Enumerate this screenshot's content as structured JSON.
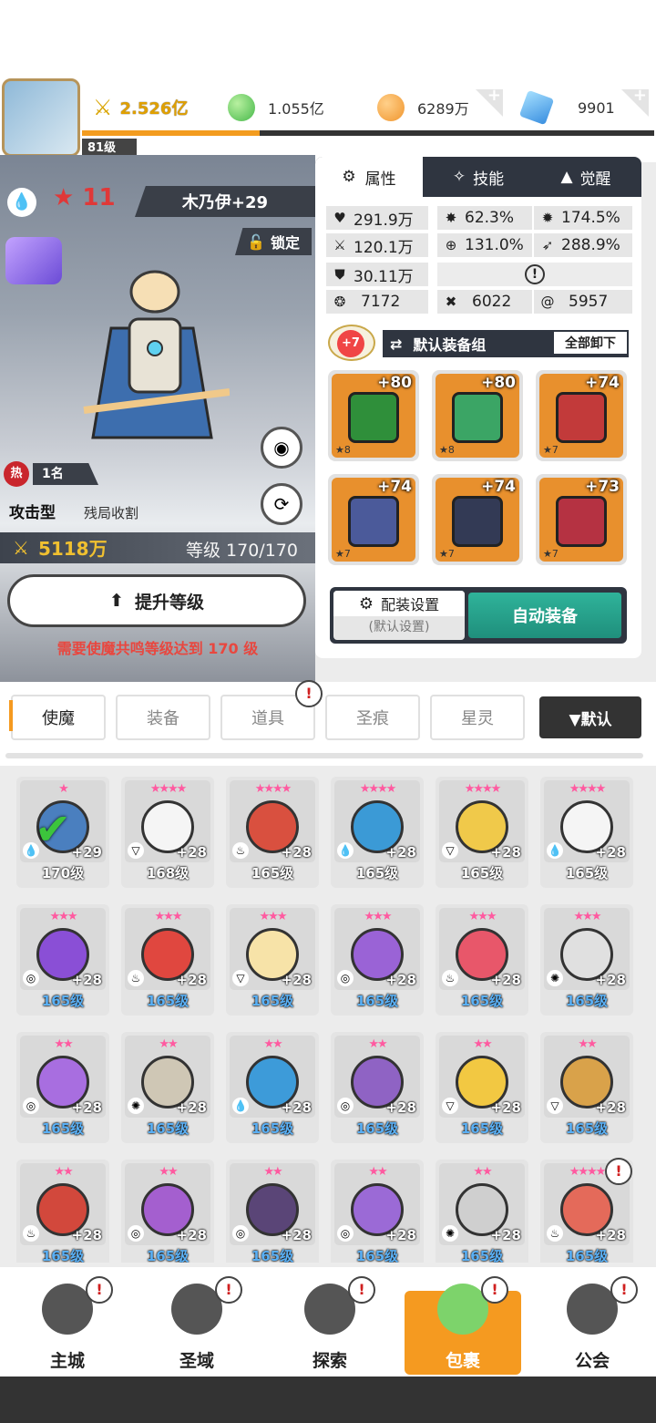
{
  "header": {
    "level": "81级",
    "power": "2.526亿",
    "currency1": "1.055亿",
    "currency2": "6289万",
    "currency3": "9901",
    "xp_progress": 0.31
  },
  "hero": {
    "star_count": "11",
    "name": "木乃伊+29",
    "lock_label": "锁定",
    "hot_badge": "热",
    "rank": "1名",
    "type": "攻击型",
    "subtitle": "残局收割",
    "power": "5118万",
    "level_text": "等级 170/170",
    "upgrade_button": "提升等级",
    "warning": "需要使魔共鸣等级达到 170 级"
  },
  "tabs": [
    {
      "label": "属性"
    },
    {
      "label": "技能"
    },
    {
      "label": "觉醒"
    }
  ],
  "stats": {
    "hp": "291.9万",
    "crit": "62.3%",
    "crit_dmg": "174.5%",
    "atk": "120.1万",
    "accuracy": "131.0%",
    "speed": "288.9%",
    "def": "30.11万",
    "s1": "7172",
    "s2": "6022",
    "s3": "5957"
  },
  "equipment": {
    "badge": "+7",
    "set_label": "默认装备组",
    "unequip_all": "全部卸下",
    "items": [
      {
        "plus": "+80",
        "stars": "★8",
        "color": "#2f8f3a"
      },
      {
        "plus": "+80",
        "stars": "★8",
        "color": "#3ba565"
      },
      {
        "plus": "+74",
        "stars": "★7",
        "color": "#c23a3a"
      },
      {
        "plus": "+74",
        "stars": "★7",
        "color": "#4b5a9a"
      },
      {
        "plus": "+74",
        "stars": "★7",
        "color": "#333a55"
      },
      {
        "plus": "+73",
        "stars": "★7",
        "color": "#b53242"
      }
    ],
    "config_label": "配装设置",
    "config_sub": "(默认设置)",
    "auto_equip": "自动装备"
  },
  "filters": [
    {
      "label": "使魔"
    },
    {
      "label": "装备"
    },
    {
      "label": "道具"
    },
    {
      "label": "圣痕"
    },
    {
      "label": "星灵"
    }
  ],
  "sort_label": "▼默认",
  "heroes": [
    {
      "level": "170级",
      "plus": "+29",
      "stars": "★",
      "color": "#4a7fbf",
      "elem": "💧"
    },
    {
      "level": "168级",
      "plus": "+28",
      "stars": "★★★★",
      "color": "#f5f5f5",
      "elem": "▽"
    },
    {
      "level": "165级",
      "plus": "+28",
      "stars": "★★★★",
      "color": "#d9503f",
      "elem": "♨"
    },
    {
      "level": "165级",
      "plus": "+28",
      "stars": "★★★★",
      "color": "#3b9ad6",
      "elem": "💧"
    },
    {
      "level": "165级",
      "plus": "+28",
      "stars": "★★★★",
      "color": "#f0c94a",
      "elem": "▽"
    },
    {
      "level": "165级",
      "plus": "+28",
      "stars": "★★★★",
      "color": "#f5f5f5",
      "elem": "💧"
    },
    {
      "level": "165级",
      "plus": "+28",
      "stars": "★★★",
      "color": "#8a4fd6",
      "elem": "◎"
    },
    {
      "level": "165级",
      "plus": "+28",
      "stars": "★★★",
      "color": "#e0473f",
      "elem": "♨"
    },
    {
      "level": "165级",
      "plus": "+28",
      "stars": "★★★",
      "color": "#f7e3a8",
      "elem": "▽"
    },
    {
      "level": "165级",
      "plus": "+28",
      "stars": "★★★",
      "color": "#9a63d6",
      "elem": "◎"
    },
    {
      "level": "165级",
      "plus": "+28",
      "stars": "★★★",
      "color": "#e8576a",
      "elem": "♨"
    },
    {
      "level": "165级",
      "plus": "+28",
      "stars": "★★★",
      "color": "#e0e0e0",
      "elem": "✺"
    },
    {
      "level": "165级",
      "plus": "+28",
      "stars": "★★",
      "color": "#a86ee0",
      "elem": "◎"
    },
    {
      "level": "165级",
      "plus": "+28",
      "stars": "★★",
      "color": "#cfc7b5",
      "elem": "✺"
    },
    {
      "level": "165级",
      "plus": "+28",
      "stars": "★★",
      "color": "#3d9bd9",
      "elem": "💧"
    },
    {
      "level": "165级",
      "plus": "+28",
      "stars": "★★",
      "color": "#8f63c4",
      "elem": "◎"
    },
    {
      "level": "165级",
      "plus": "+28",
      "stars": "★★",
      "color": "#f2c842",
      "elem": "▽"
    },
    {
      "level": "165级",
      "plus": "+28",
      "stars": "★★",
      "color": "#d9a24a",
      "elem": "▽"
    },
    {
      "level": "165级",
      "plus": "+28",
      "stars": "★★",
      "color": "#d2483c",
      "elem": "♨"
    },
    {
      "level": "165级",
      "plus": "+28",
      "stars": "★★",
      "color": "#a45fcf",
      "elem": "◎"
    },
    {
      "level": "165级",
      "plus": "+28",
      "stars": "★★",
      "color": "#5a4577",
      "elem": "◎"
    },
    {
      "level": "165级",
      "plus": "+28",
      "stars": "★★",
      "color": "#9b6ad6",
      "elem": "◎"
    },
    {
      "level": "165级",
      "plus": "+28",
      "stars": "★★",
      "color": "#cfcfcf",
      "elem": "✺"
    },
    {
      "level": "165级",
      "plus": "+28",
      "stars": "★★★★",
      "color": "#e46a5a",
      "elem": "♨"
    }
  ],
  "nav": [
    {
      "label": "主城"
    },
    {
      "label": "圣域"
    },
    {
      "label": "探索"
    },
    {
      "label": "包裹"
    },
    {
      "label": "公会"
    }
  ]
}
